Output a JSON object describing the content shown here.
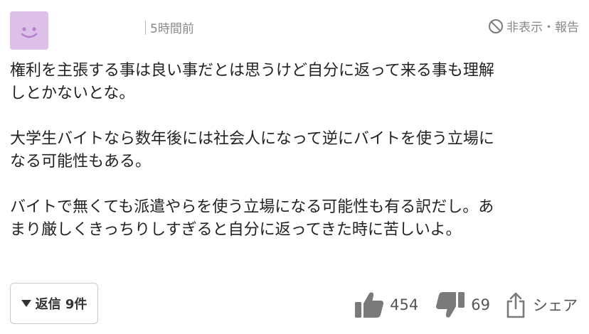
{
  "comment": {
    "timestamp": "5時間前",
    "report_label": "非表示・報告",
    "paragraphs": [
      [
        "権利を主張する事は良い事だとは思うけど自分に返って来る事も理解",
        "しとかないとな。"
      ],
      [
        "大学生バイトなら数年後には社会人になって逆にバイトを使う立場に",
        "なる可能性もある。"
      ],
      [
        "バイトで無くても派遣やらを使う立場になる可能性も有る訳だし。あ",
        "まり厳しくきっちりしすぎると自分に返ってきた時に苦しいよ。"
      ]
    ]
  },
  "footer": {
    "reply_label": "返信 9件",
    "like_count": "454",
    "dislike_count": "69",
    "share_label": "シェア"
  },
  "icons": {
    "avatar": "smiley-face-icon",
    "report": "prohibited-icon",
    "reply": "triangle-down-icon",
    "like": "thumbs-up-icon",
    "dislike": "thumbs-down-icon",
    "share": "share-icon"
  },
  "colors": {
    "avatar_bg": "#dcc0e8",
    "avatar_face": "#b77fd0",
    "icon_gray": "#7a7a7a",
    "meta_text": "#8a8a8a"
  }
}
